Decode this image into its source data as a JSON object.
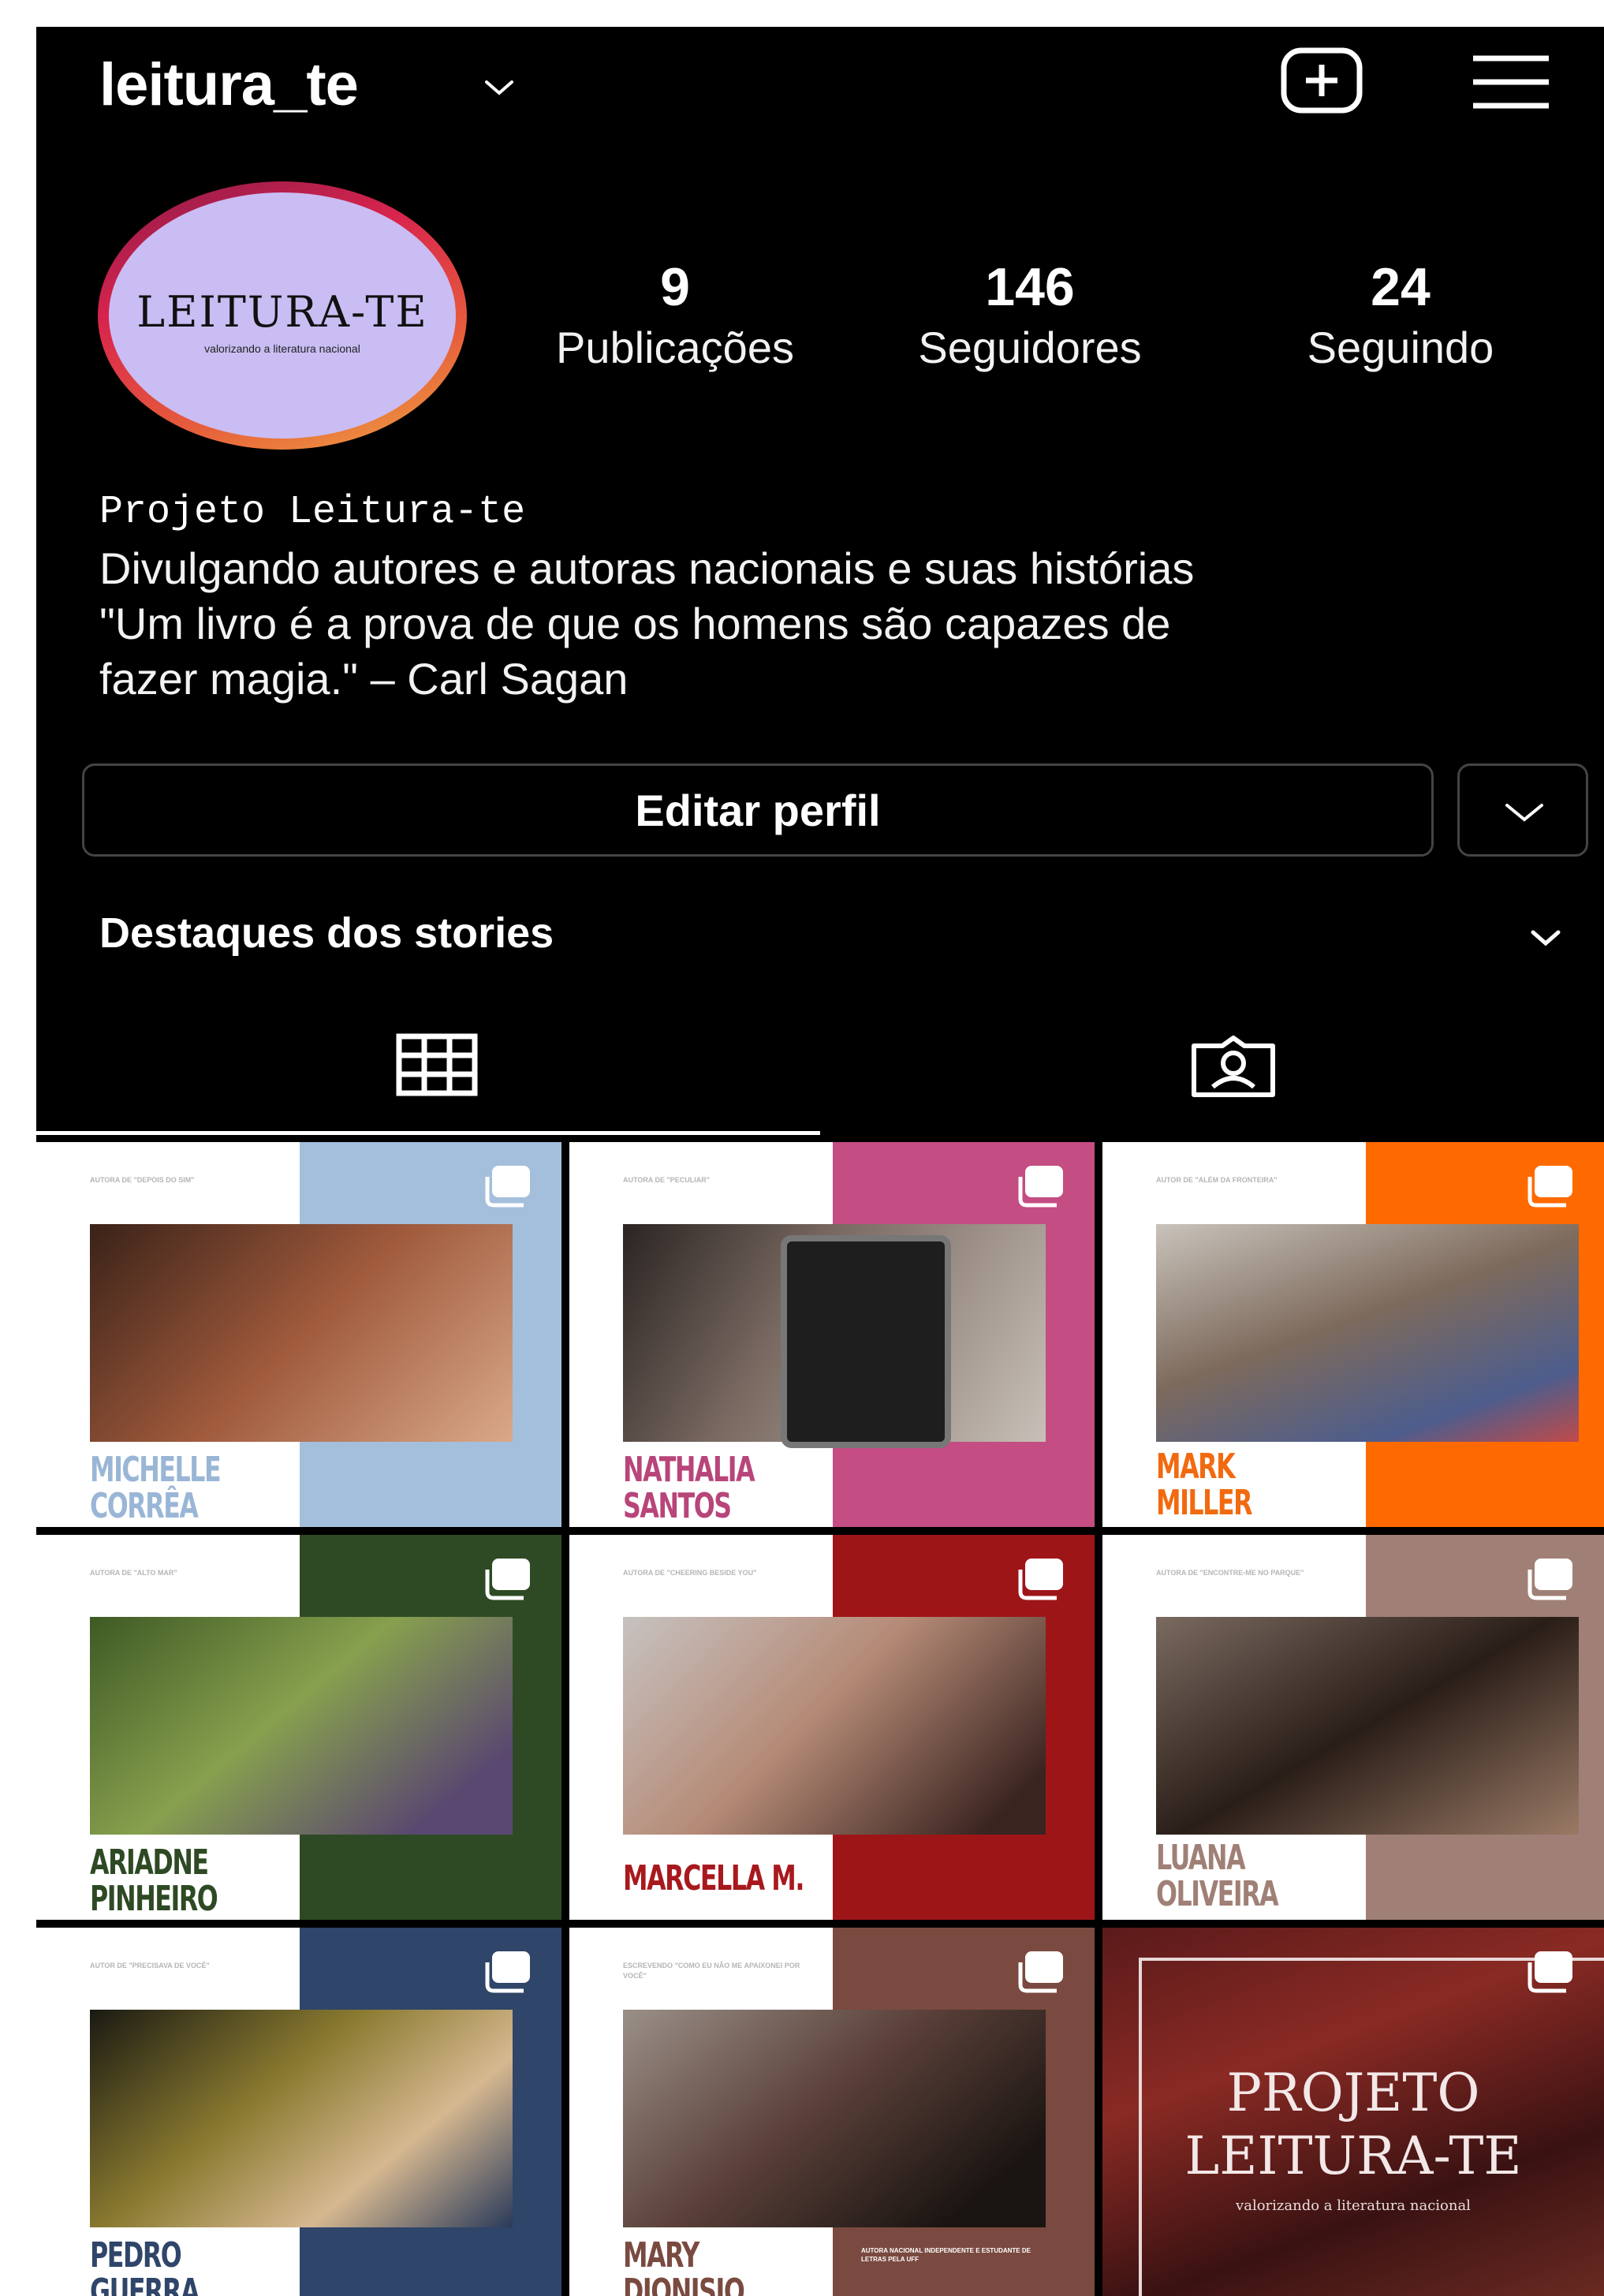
{
  "app": {
    "username": "leitura_te"
  },
  "profile": {
    "avatar_logo": "LEITURA-TE",
    "avatar_tagline": "valorizando a literatura nacional",
    "stats": [
      {
        "value": "9",
        "label": "Publicações"
      },
      {
        "value": "146",
        "label": "Seguidores"
      },
      {
        "value": "24",
        "label": "Seguindo"
      }
    ],
    "bio_name": "Projeto Leitura-te",
    "bio_lines": [
      "Divulgando autores e autoras nacionais e suas histórias",
      "\"Um livro é a prova de que os homens são capazes de",
      "fazer magia.\" – Carl Sagan"
    ]
  },
  "actions": {
    "edit_profile": "Editar perfil"
  },
  "highlights": {
    "label": "Destaques dos stories"
  },
  "tabs": [
    {
      "icon": "grid-icon"
    },
    {
      "icon": "tagged-icon"
    }
  ],
  "posts": [
    {
      "caption": "AUTORA DE \"DEPOIS DO SIM\"",
      "name1": "MICHELLE",
      "name2": "CORRÊA",
      "accent": "#a4bfdc",
      "name_color": "#9ab6d6",
      "photo": "#7a4a3a"
    },
    {
      "caption": "AUTORA DE \"PECULIAR\"",
      "name1": "NATHALIA",
      "name2": "SANTOS",
      "accent": "#c44d83",
      "name_color": "#b8457a",
      "photo": "#5a5552"
    },
    {
      "caption": "AUTOR DE \"ALÉM DA FRONTEIRA\"",
      "name1": "MARK",
      "name2": "MILLER",
      "accent": "#ff6a00",
      "name_color": "#f26a0f",
      "photo": "#9a8f80"
    },
    {
      "caption": "AUTORA DE \"ALTO MAR\"",
      "name1": "ARIADNE",
      "name2": "PINHEIRO",
      "accent": "#2e4a24",
      "name_color": "#2e4a24",
      "photo": "#4f6a34"
    },
    {
      "caption": "AUTORA DE \"CHEERING BESIDE YOU\"",
      "name1": "MARCELLA M.",
      "name2": "",
      "accent": "#9e1518",
      "name_color": "#a8191d",
      "photo": "#7a5a4e"
    },
    {
      "caption": "AUTORA DE \"ENCONTRE-ME NO PARQUE\"",
      "name1": "LUANA",
      "name2": "OLIVEIRA",
      "accent": "#a08076",
      "name_color": "#a08076",
      "photo": "#5c4c44"
    },
    {
      "caption": "AUTOR DE \"PRECISAVA DE VOCÊ\"",
      "name1": "PEDRO",
      "name2": "GUERRA",
      "accent": "#2f4569",
      "name_color": "#2f4569",
      "photo": "#6a6040"
    },
    {
      "caption": "ESCREVENDO \"COMO EU NÃO ME APAIXONEI POR VOCÊ\"",
      "name1": "MARY",
      "name2": "DIONISIO",
      "accent": "#7a4a40",
      "name_color": "#7a4a40",
      "photo": "#4a3c38",
      "extra": "AUTORA NACIONAL INDEPENDENTE E ESTUDANTE DE LETRAS PELA UFF"
    },
    {
      "final_title1": "PROJETO",
      "final_title2": "LEITURA-TE",
      "final_tag": "valorizando a literatura nacional"
    }
  ],
  "colors": {
    "background": "#000000",
    "text": "#ffffff",
    "border": "#444444"
  }
}
